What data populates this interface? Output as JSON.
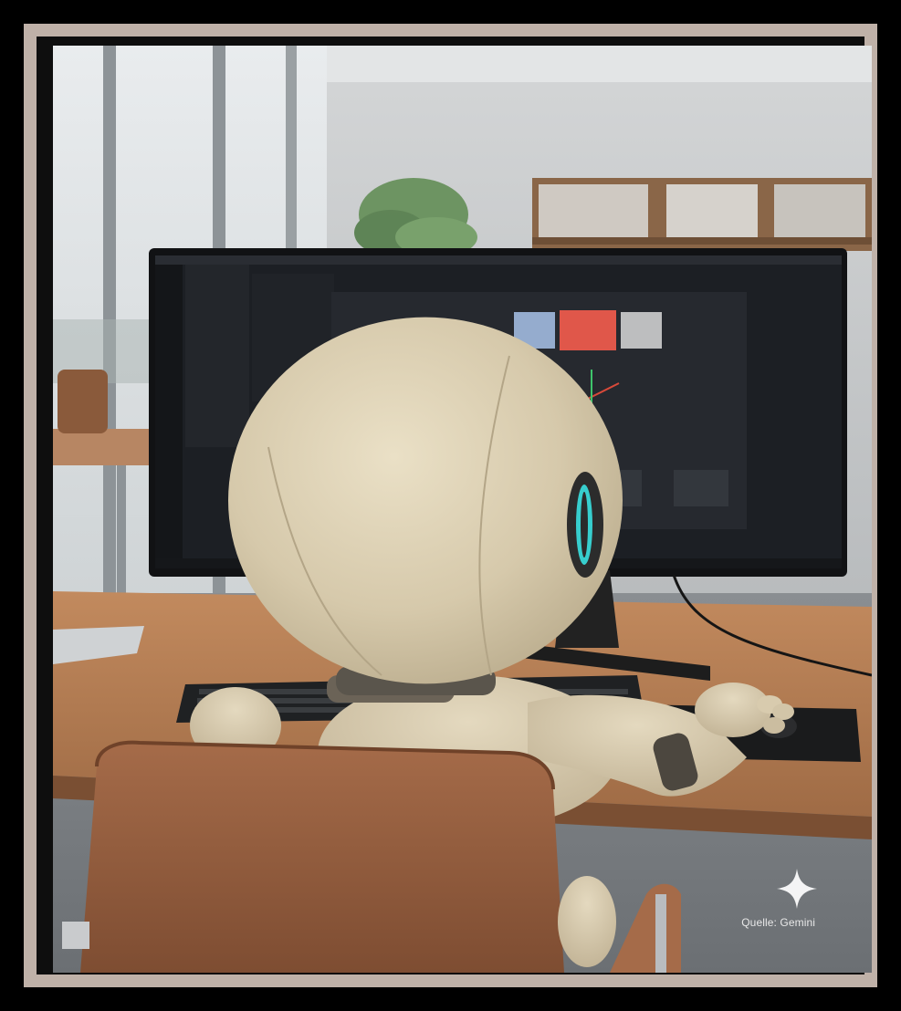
{
  "photo": {
    "subject": "robot-at-computer",
    "credit": "Quelle: Gemini"
  },
  "colors": {
    "frame_outer": "#000000",
    "frame_mat": "#bfb1a8",
    "robot_body": "#d9cdb0",
    "robot_eye_glow": "#38e0e0",
    "desk": "#b77e54",
    "chair": "#9a6344",
    "screen_bg": "#1c1f24"
  },
  "icons": {
    "sparkle": "gemini-sparkle-icon"
  }
}
